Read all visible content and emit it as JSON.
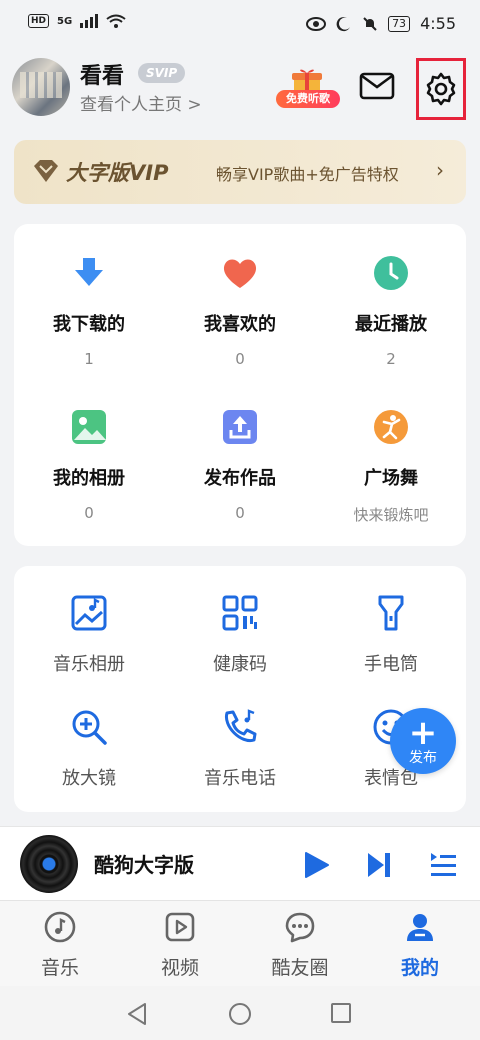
{
  "status_bar": {
    "network": "HD",
    "signal": "5G",
    "battery": "73",
    "time": "4:55"
  },
  "profile": {
    "username": "看看",
    "badge": "SVIP",
    "homepage_link": "查看个人主页 >",
    "gift_label": "免费听歌"
  },
  "vip_banner": {
    "title": "大字版VIP",
    "description": "畅享VIP歌曲+免广告特权"
  },
  "stats": [
    {
      "label": "我下载的",
      "value": "1",
      "icon": "download-icon",
      "color": "#3d8ef2"
    },
    {
      "label": "我喜欢的",
      "value": "0",
      "icon": "heart-icon",
      "color": "#f0664e"
    },
    {
      "label": "最近播放",
      "value": "2",
      "icon": "clock-icon",
      "color": "#3fbf9c"
    },
    {
      "label": "我的相册",
      "value": "0",
      "icon": "photo-icon",
      "color": "#4cc482"
    },
    {
      "label": "发布作品",
      "value": "0",
      "icon": "upload-icon",
      "color": "#6c86f0"
    },
    {
      "label": "广场舞",
      "value": "快来锻炼吧",
      "icon": "dance-icon",
      "color": "#f59a3a"
    }
  ],
  "tools": [
    {
      "label": "音乐相册",
      "icon": "music-album-icon"
    },
    {
      "label": "健康码",
      "icon": "qr-code-icon"
    },
    {
      "label": "手电筒",
      "icon": "flashlight-icon"
    },
    {
      "label": "放大镜",
      "icon": "magnifier-icon"
    },
    {
      "label": "音乐电话",
      "icon": "music-phone-icon"
    },
    {
      "label": "表情包",
      "icon": "emoji-icon"
    }
  ],
  "fab": {
    "label": "发布"
  },
  "player": {
    "title": "酷狗大字版"
  },
  "tabs": [
    {
      "label": "音乐",
      "icon": "music-note-icon"
    },
    {
      "label": "视频",
      "icon": "video-play-icon"
    },
    {
      "label": "酷友圈",
      "icon": "chat-bubble-icon"
    },
    {
      "label": "我的",
      "icon": "user-icon"
    }
  ],
  "active_tab": "我的",
  "colors": {
    "accent": "#1e6ae0",
    "highlight_border": "#e6223a",
    "vip_text": "#6b5330"
  }
}
